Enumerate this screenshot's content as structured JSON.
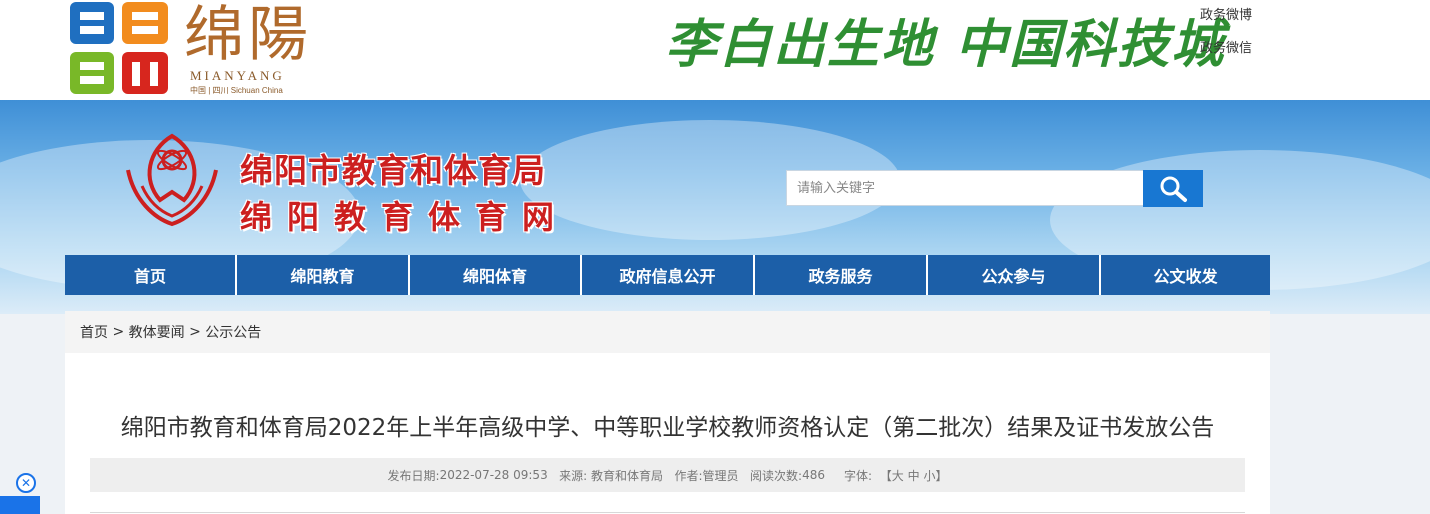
{
  "topbar": {
    "city_name_cn": "绵陽",
    "city_name_en": "MIANYANG",
    "city_sub": "中国 | 四川 Sichuan China",
    "slogan": "李白出生地 中国科技城",
    "links": [
      "政务微博",
      "政务微信"
    ]
  },
  "header": {
    "site_title": "绵阳市教育和体育局",
    "site_subtitle": "绵阳教育体育网",
    "search_placeholder": "请输入关键字"
  },
  "nav": {
    "items": [
      "首页",
      "绵阳教育",
      "绵阳体育",
      "政府信息公开",
      "政务服务",
      "公众参与",
      "公文收发"
    ]
  },
  "breadcrumb": {
    "items": [
      "首页",
      "教体要闻",
      "公示公告"
    ],
    "separator": ">"
  },
  "article": {
    "title": "绵阳市教育和体育局2022年上半年高级中学、中等职业学校教师资格认定（第二批次）结果及证书发放公告",
    "meta": {
      "date_label": "发布日期:",
      "date": "2022-07-28 09:53",
      "source_label": "来源:",
      "source": "教育和体育局",
      "author_label": "作者:",
      "author": "管理员",
      "views_label": "阅读次数:",
      "views": "486",
      "font_label": "字体:",
      "font_open": "【",
      "font_large": "大",
      "font_medium": "中",
      "font_small": "小",
      "font_close": "】"
    }
  },
  "colors": {
    "nav_bg": "#1c5fa8",
    "title_red": "#cc1f1f",
    "search_blue": "#1877d2",
    "slogan_green": "#2f8f33"
  },
  "icons": {
    "search": "search-icon",
    "close": "close-icon"
  }
}
